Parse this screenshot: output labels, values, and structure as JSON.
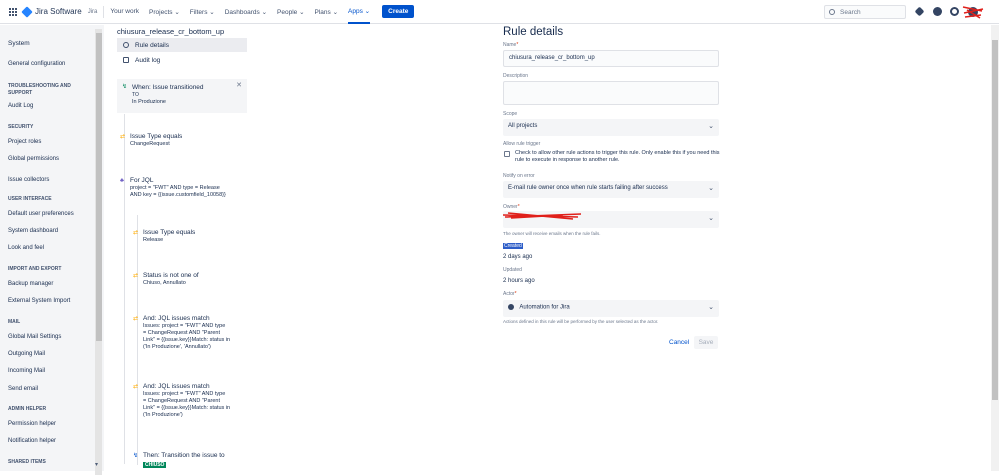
{
  "topbar": {
    "product": "Jira Software",
    "product_sub": "Jira",
    "nav": [
      "Your work",
      "Projects ⌄",
      "Filters ⌄",
      "Dashboards ⌄",
      "People ⌄",
      "Plans ⌄",
      "Apps ⌄"
    ],
    "create_label": "Create",
    "search_placeholder": "Search"
  },
  "sidebar": {
    "items": [
      {
        "type": "item",
        "label": "System"
      },
      {
        "type": "item",
        "label": "General configuration"
      },
      {
        "type": "head",
        "label": "TROUBLESHOOTING AND SUPPORT"
      },
      {
        "type": "item",
        "label": "Audit Log"
      },
      {
        "type": "head",
        "label": "SECURITY"
      },
      {
        "type": "item",
        "label": "Project roles"
      },
      {
        "type": "item",
        "label": "Global permissions"
      },
      {
        "type": "item",
        "label": "Issue collectors"
      },
      {
        "type": "head",
        "label": "USER INTERFACE"
      },
      {
        "type": "item",
        "label": "Default user preferences"
      },
      {
        "type": "item",
        "label": "System dashboard"
      },
      {
        "type": "item",
        "label": "Look and feel"
      },
      {
        "type": "head",
        "label": "IMPORT AND EXPORT"
      },
      {
        "type": "item",
        "label": "Backup manager"
      },
      {
        "type": "item",
        "label": "External System Import"
      },
      {
        "type": "head",
        "label": "MAIL"
      },
      {
        "type": "item",
        "label": "Global Mail Settings"
      },
      {
        "type": "item",
        "label": "Outgoing Mail"
      },
      {
        "type": "item",
        "label": "Incoming Mail"
      },
      {
        "type": "item",
        "label": "Send email"
      },
      {
        "type": "head",
        "label": "ADMIN HELPER"
      },
      {
        "type": "item",
        "label": "Permission helper"
      },
      {
        "type": "item",
        "label": "Notification helper"
      },
      {
        "type": "head",
        "label": "SHARED ITEMS"
      }
    ]
  },
  "rule": {
    "name": "chiusura_release_cr_bottom_up",
    "subnav": [
      "Rule details",
      "Audit log"
    ],
    "steps": [
      {
        "title": "When: Issue transitioned",
        "body": [
          "TO",
          "In Produzione"
        ],
        "icon": "trigger-icon"
      },
      {
        "title": "Issue Type equals",
        "body": [
          "ChangeRequest"
        ],
        "icon": "condition-icon"
      },
      {
        "title": "For JQL",
        "body": [
          "project = \"FWT\" AND type = Release",
          "AND key = {{issue.customfield_10058}}"
        ],
        "icon": "branch-icon"
      },
      {
        "title": "Issue Type equals",
        "body": [
          "Release"
        ],
        "icon": "condition-icon"
      },
      {
        "title": "Status is not one of",
        "body": [
          "Chiuso, Annullato"
        ],
        "icon": "condition-icon"
      },
      {
        "title": "And: JQL issues match",
        "body": [
          "Issues: project = \"FWT\" AND type",
          "= ChangeRequest AND \"Parent",
          "Link\" = {{issue.key}}Match: status in",
          "('In Produzione', 'Annullato')"
        ],
        "icon": "condition-icon"
      },
      {
        "title": "And: JQL issues match",
        "body": [
          "Issues: project = \"FWT\" AND type",
          "= ChangeRequest AND \"Parent",
          "Link\" = {{issue.key}}Match: status in",
          "('In Produzione')"
        ],
        "icon": "condition-icon"
      },
      {
        "title": "Then: Transition the issue to",
        "body": [],
        "lozenge": "CHIUSO",
        "icon": "action-icon"
      }
    ]
  },
  "details": {
    "title": "Rule details",
    "name_label": "Name",
    "name_value": "chiusura_release_cr_bottom_up",
    "description_label": "Description",
    "scope_label": "Scope",
    "scope_value": "All projects",
    "allow_label": "Allow rule trigger",
    "allow_text": "Check to allow other rule actions to trigger this rule. Only enable this if you need this rule to execute in response to another rule.",
    "notify_label": "Notify on error",
    "notify_value": "E-mail rule owner once when rule starts failing after success",
    "owner_label": "Owner",
    "owner_help": "The owner will receive emails when the rule fails.",
    "created_label": "Created",
    "created_value": "2 days ago",
    "updated_label": "Updated",
    "updated_value": "2 hours ago",
    "actor_label": "Actor",
    "actor_value": "Automation for Jira",
    "actor_help": "Actions defined in this rule will be performed by the user selected as the actor.",
    "cancel_label": "Cancel",
    "save_label": "Save"
  }
}
